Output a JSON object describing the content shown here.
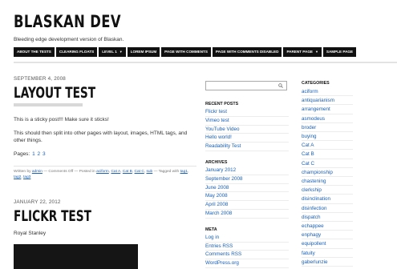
{
  "site": {
    "title": "BLASKAN DEV",
    "description": "Bleeding edge development version of Blaskan."
  },
  "nav": [
    {
      "label": "About The Tests",
      "caret": ""
    },
    {
      "label": "Clearing Floats",
      "caret": ""
    },
    {
      "label": "Level 1",
      "caret": "▼"
    },
    {
      "label": "Lorem Ipsum",
      "caret": ""
    },
    {
      "label": "Page with comments",
      "caret": ""
    },
    {
      "label": "Page with comments disabled",
      "caret": ""
    },
    {
      "label": "Parent Page",
      "caret": "▼"
    },
    {
      "label": "Sample Page",
      "caret": ""
    }
  ],
  "posts": [
    {
      "date": "September 4, 2008",
      "title": "LAYOUT TEST",
      "body1": "This is a sticky post!!! Make sure it sticks!",
      "body2": "This should then split into other pages with layout, images, HTML tags, and other things.",
      "pages_label": "Pages:",
      "pages": [
        "1",
        "2",
        "3"
      ],
      "meta_prefix": "Written by",
      "meta_author": "admin",
      "meta_comments": "— Comments Off — Posted in",
      "meta_cats": [
        "aciform",
        "Cat A",
        "Cat B",
        "Cat C",
        "sub"
      ],
      "meta_tagged": "— Tagged with",
      "meta_tags": [
        "tag1",
        "tag2",
        "tag3"
      ]
    },
    {
      "date": "January 22, 2012",
      "title": "FLICKR TEST",
      "body1": "Royal Stanley"
    }
  ],
  "sidebar": {
    "search_placeholder": "",
    "recent_heading": "Recent Posts",
    "recent": [
      "Flickr test",
      "Vimeo test",
      "YouTube Video",
      "Hello world!",
      "Readability Test"
    ],
    "archives_heading": "Archives",
    "archives": [
      "January 2012",
      "September 2008",
      "June 2008",
      "May 2008",
      "April 2008",
      "March 2008"
    ],
    "meta_heading": "Meta",
    "meta": [
      "Log in",
      "Entries RSS",
      "Comments RSS",
      "WordPress.org"
    ]
  },
  "categories": {
    "heading": "Categories",
    "items": [
      "aciform",
      "antiquarianism",
      "arrangement",
      "asmodeus",
      "broder",
      "buying",
      "Cat A",
      "Cat B",
      "Cat C",
      "championship",
      "chastening",
      "clerkship",
      "disinclination",
      "disinfection",
      "dispatch",
      "echappee",
      "enphagy",
      "equipollent",
      "fatuity",
      "gaberlunzie"
    ]
  }
}
